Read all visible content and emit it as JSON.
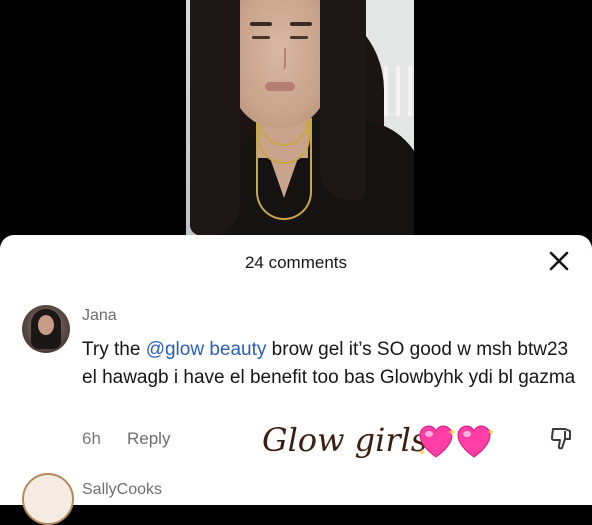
{
  "sheet": {
    "title": "24 comments"
  },
  "comment": {
    "username": "Jana",
    "prefix": "Try the ",
    "mention": "@glow beauty",
    "body": " brow gel it’s SO good w msh btw23 el hawagb i have el benefit too bas Glowbyhk ydi bl gazma",
    "time": "6h",
    "reply_label": "Reply"
  },
  "overlay": {
    "text": "Glow girls",
    "emoji": "sparkling-heart-emoji x2"
  },
  "next_comment": {
    "username": "SallyCooks"
  },
  "colors": {
    "mention": "#2b5db8",
    "sheet_bg": "#ffffff",
    "overlay_text": "#3a1e10",
    "heart": "#ff3ea5"
  }
}
